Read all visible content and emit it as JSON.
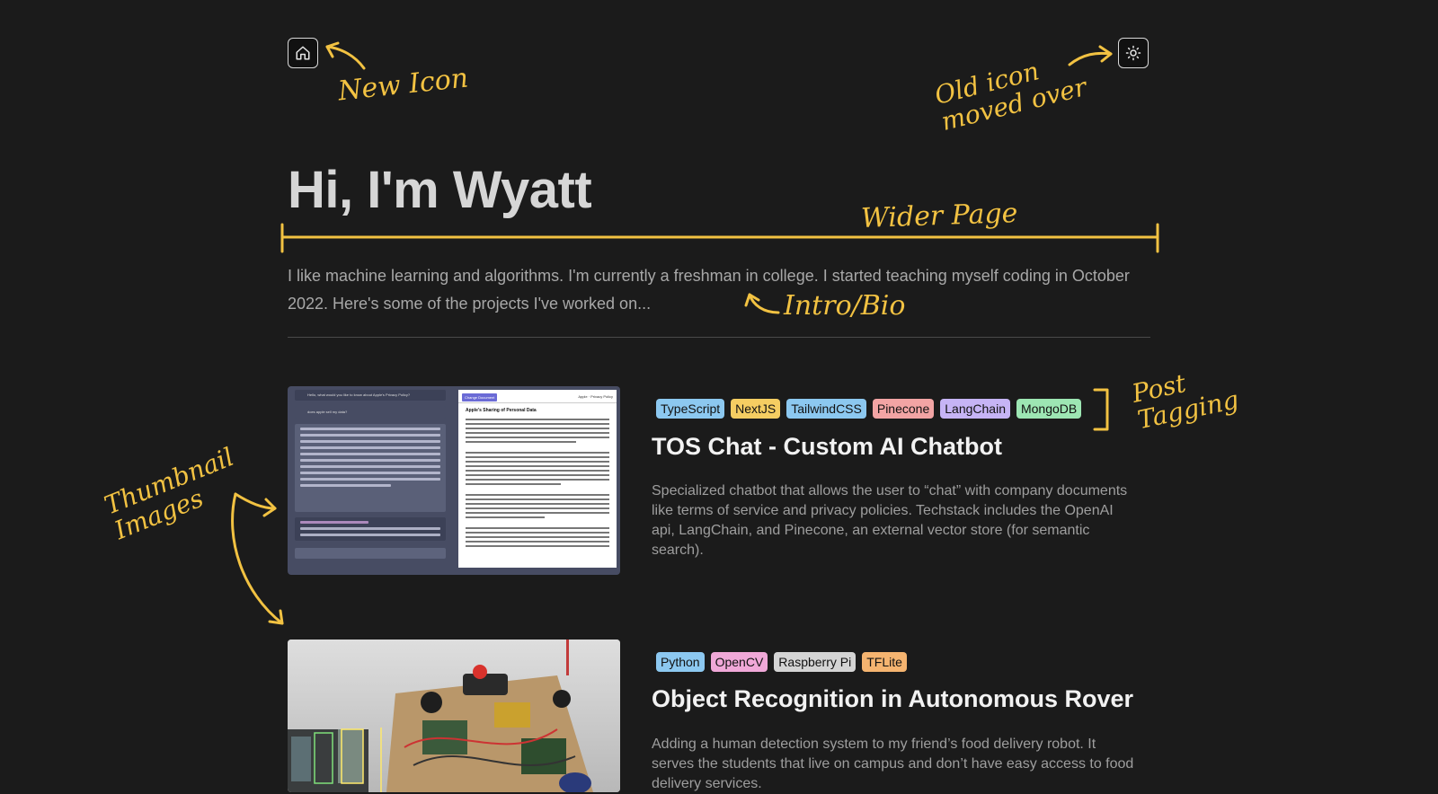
{
  "header": {
    "home_icon": "home-icon",
    "theme_icon": "sun-icon"
  },
  "hero": {
    "title": "Hi, I'm Wyatt",
    "bio": "I like machine learning and algorithms. I'm currently a freshman in college. I started teaching myself coding in October 2022. Here's some of the projects I've worked on..."
  },
  "projects": [
    {
      "tags": [
        {
          "label": "TypeScript",
          "color": "#8cc8f0"
        },
        {
          "label": "NextJS",
          "color": "#f5cd62"
        },
        {
          "label": "TailwindCSS",
          "color": "#8cc8f0"
        },
        {
          "label": "Pinecone",
          "color": "#f2a4a4"
        },
        {
          "label": "LangChain",
          "color": "#c6b4f5"
        },
        {
          "label": "MongoDB",
          "color": "#9de6b3"
        }
      ],
      "title": "TOS Chat - Custom AI Chatbot",
      "description": "Specialized chatbot that allows the user to “chat” with company documents like terms of service and privacy policies. Techstack includes the OpenAI api, LangChain, and Pinecone, an external vector store (for semantic search)."
    },
    {
      "tags": [
        {
          "label": "Python",
          "color": "#8cc8f0"
        },
        {
          "label": "OpenCV",
          "color": "#f0a8d8"
        },
        {
          "label": "Raspberry Pi",
          "color": "#d4d4d4"
        },
        {
          "label": "TFLite",
          "color": "#f5b470"
        }
      ],
      "title": "Object Recognition in Autonomous Rover",
      "description": "Adding a human detection system to my friend’s food delivery robot. It serves the students that live on campus and don’t have easy access to food delivery services."
    }
  ],
  "annotations": {
    "new_icon": "New Icon",
    "old_icon": "Old icon\nmoved over",
    "wider_page": "Wider Page",
    "intro_bio": "Intro/Bio",
    "post_tagging": "Post\nTagging",
    "thumbnail_images": "Thumbnail\nImages",
    "color": "#f2c242"
  },
  "thumbnail_1_text": {
    "question": "Hello, what would you like to know about Apple's Privacy Policy?",
    "user": "does apple sell my data?",
    "button": "Change Document",
    "doc_label": "Apple · Privacy Policy",
    "doc_heading": "Apple's Sharing of Personal Data"
  }
}
